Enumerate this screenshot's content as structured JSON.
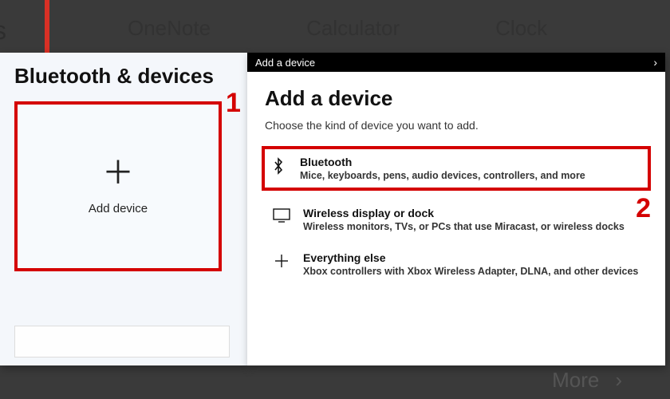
{
  "background": {
    "apps": [
      "OneNote",
      "Calculator",
      "Clock"
    ],
    "more": "More",
    "partial_left": "s"
  },
  "settings": {
    "title": "Bluetooth & devices",
    "add_device": "Add device"
  },
  "markers": {
    "m1": "1",
    "m2": "2"
  },
  "dialog": {
    "header": "Add a device",
    "title": "Add a device",
    "subtitle": "Choose the kind of device you want to add.",
    "options": [
      {
        "title": "Bluetooth",
        "desc": "Mice, keyboards, pens, audio devices, controllers, and more"
      },
      {
        "title": "Wireless display or dock",
        "desc": "Wireless monitors, TVs, or PCs that use Miracast, or wireless docks"
      },
      {
        "title": "Everything else",
        "desc": "Xbox controllers with Xbox Wireless Adapter, DLNA, and other devices"
      }
    ]
  }
}
